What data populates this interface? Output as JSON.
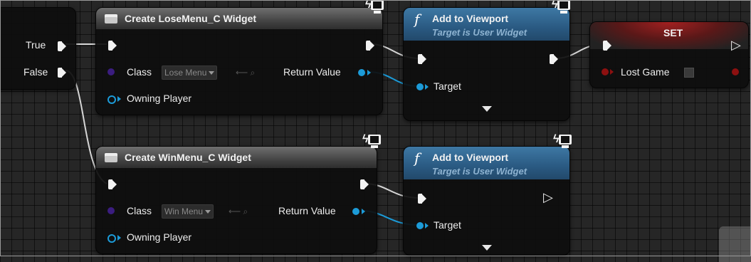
{
  "branch": {
    "true_label": "True",
    "false_label": "False"
  },
  "create_lose": {
    "title": "Create LoseMenu_C Widget",
    "class_label": "Class",
    "class_value": "Lose Menu",
    "return_label": "Return Value",
    "owning_label": "Owning Player"
  },
  "add_viewport_top": {
    "title": "Add to Viewport",
    "subtitle": "Target is User Widget",
    "target_label": "Target"
  },
  "set_node": {
    "title": "SET",
    "var_label": "Lost Game"
  },
  "create_win": {
    "title": "Create WinMenu_C Widget",
    "class_label": "Class",
    "class_value": "Win Menu",
    "return_label": "Return Value",
    "owning_label": "Owning Player"
  },
  "add_viewport_bottom": {
    "title": "Add to Viewport",
    "subtitle": "Target is User Widget",
    "target_label": "Target"
  },
  "colors": {
    "exec_wire": "#d6d6d6",
    "object_pin": "#1c9bd8",
    "class_pin": "#3b1d80",
    "bool_pin": "#8d1010",
    "function_header": "#2a5a82"
  },
  "icons": [
    "widget-icon",
    "function-icon",
    "latent-clock-icon",
    "expand-arrow-icon"
  ]
}
